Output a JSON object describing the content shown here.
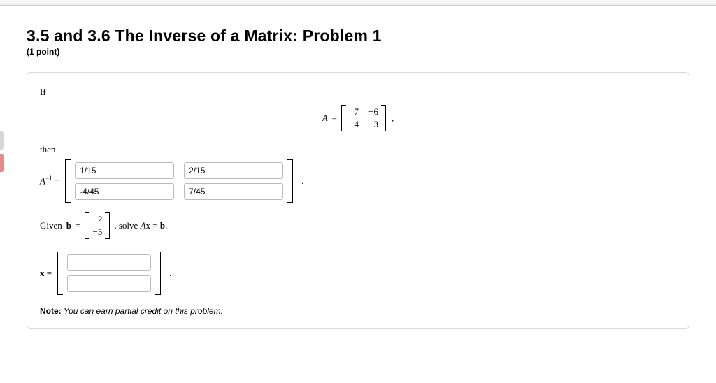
{
  "header": {
    "title": "3.5 and 3.6 The Inverse of a Matrix: Problem 1",
    "points": "(1 point)"
  },
  "problem": {
    "if_text": "If",
    "A_label": "A",
    "eq_sign": "=",
    "A_matrix": {
      "r1c1": "7",
      "r1c2": "−6",
      "r2c1": "4",
      "r2c2": "3"
    },
    "A_trailing": ",",
    "then_text": "then",
    "Ainv_label_html": "A",
    "Ainv_sup": "−1",
    "Ainv_inputs": {
      "r1c1": "1/15",
      "r1c2": "2/15",
      "r2c1": "-4/45",
      "r2c2": "7/45"
    },
    "Ainv_trailing": ".",
    "given_prefix": "Given ",
    "b_label": "b",
    "b_matrix": {
      "r1": "−2",
      "r2": "−5"
    },
    "solve_text": ", solve ",
    "Ax_expr_A": "A",
    "Ax_expr_x": "x",
    "Ax_eq": " = ",
    "Ax_expr_b": "b",
    "Ax_period": ".",
    "x_label": "x",
    "x_inputs": {
      "r1": "",
      "r2": ""
    },
    "x_trailing": ".",
    "note_bold": "Note:",
    "note_text": " You can earn partial credit on this problem."
  }
}
